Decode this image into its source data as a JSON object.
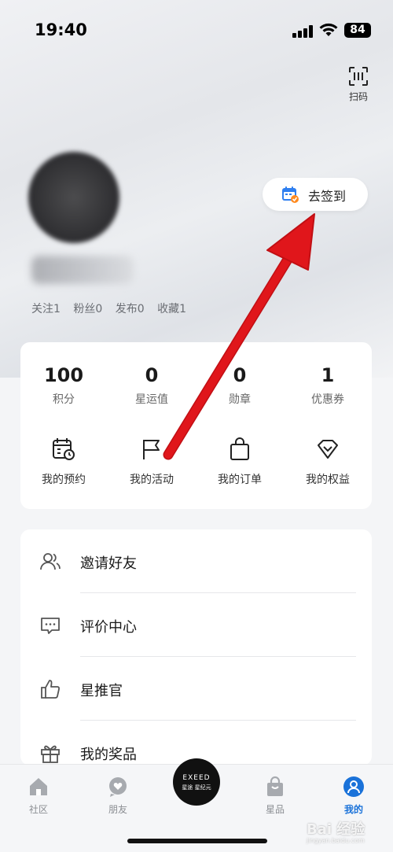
{
  "status_bar": {
    "time": "19:40",
    "battery": "84"
  },
  "header": {
    "scan_label": "扫码"
  },
  "profile": {
    "stats": [
      {
        "label": "关注",
        "value": "1"
      },
      {
        "label": "粉丝",
        "value": "0"
      },
      {
        "label": "发布",
        "value": "0"
      },
      {
        "label": "收藏",
        "value": "1"
      }
    ],
    "checkin_label": "去签到"
  },
  "summary": {
    "stats": [
      {
        "value": "100",
        "label": "积分"
      },
      {
        "value": "0",
        "label": "星运值"
      },
      {
        "value": "0",
        "label": "勋章"
      },
      {
        "value": "1",
        "label": "优惠券"
      }
    ],
    "quick_links": [
      {
        "label": "我的预约",
        "icon": "calendar-clock-icon"
      },
      {
        "label": "我的活动",
        "icon": "flag-icon"
      },
      {
        "label": "我的订单",
        "icon": "shopping-bag-icon"
      },
      {
        "label": "我的权益",
        "icon": "diamond-icon"
      }
    ]
  },
  "menu": [
    {
      "label": "邀请好友",
      "icon": "users-icon"
    },
    {
      "label": "评价中心",
      "icon": "comment-icon"
    },
    {
      "label": "星推官",
      "icon": "thumbs-up-icon"
    },
    {
      "label": "我的奖品",
      "icon": "gift-icon"
    }
  ],
  "tabbar": {
    "items": [
      {
        "label": "社区",
        "icon": "home-icon",
        "active": false
      },
      {
        "label": "朋友",
        "icon": "heart-chat-icon",
        "active": false
      },
      {
        "label": "星品",
        "icon": "bag-icon",
        "active": false
      },
      {
        "label": "我的",
        "icon": "profile-icon",
        "active": true
      }
    ],
    "center_brand": "EXEED",
    "center_subtitle": "星途 星纪元"
  },
  "watermark": {
    "text": "Bai 经验",
    "subtext": "jingyan.baidu.com"
  },
  "colors": {
    "accent": "#1a72d9",
    "arrow": "#e0161b",
    "checkin_icon": "#2f7ff0",
    "checkin_badge": "#ff8a1f"
  }
}
